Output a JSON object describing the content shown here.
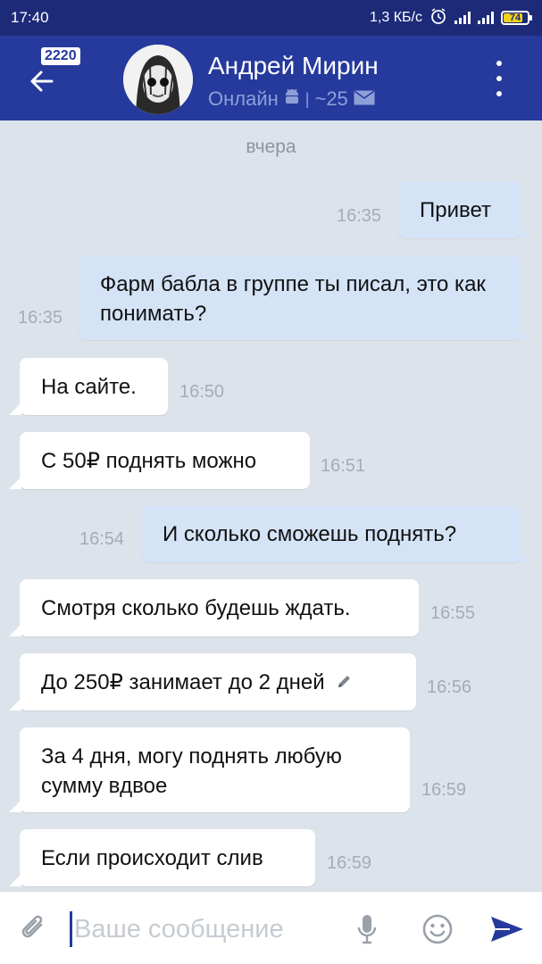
{
  "status_bar": {
    "time": "17:40",
    "speed": "1,3 КБ/с",
    "battery": "74"
  },
  "header": {
    "back_badge": "2220",
    "contact_name": "Андрей Мирин",
    "status_text": "Онлайн",
    "status_count": "~25"
  },
  "chat": {
    "date_separator": "вчера",
    "messages": [
      {
        "dir": "out",
        "text": "Привет",
        "time": "16:35"
      },
      {
        "dir": "out",
        "text": "Фарм бабла в группе ты писал, это как понимать?",
        "time": "16:35"
      },
      {
        "dir": "in",
        "text": "На сайте.",
        "time": "16:50"
      },
      {
        "dir": "in",
        "text": "С 50₽ поднять можно",
        "time": "16:51"
      },
      {
        "dir": "out",
        "text": "И сколько сможешь поднять?",
        "time": "16:54"
      },
      {
        "dir": "in",
        "text": "Смотря сколько будешь ждать.",
        "time": "16:55"
      },
      {
        "dir": "in",
        "text": "До 250₽ занимает до 2 дней",
        "time": "16:56",
        "edited": true
      },
      {
        "dir": "in",
        "text": "За 4 дня, могу поднять любую сумму вдвое",
        "time": "16:59"
      },
      {
        "dir": "in",
        "text": "Если происходит слив",
        "time": "16:59"
      }
    ]
  },
  "composer": {
    "placeholder": "Ваше сообщение"
  },
  "colors": {
    "status_bar": "#1c2a78",
    "app_bar": "#253a9c",
    "chat_bg": "#dde3ea",
    "bubble_in": "#ffffff",
    "bubble_out": "#d4e3f6",
    "accent": "#253a9c"
  }
}
